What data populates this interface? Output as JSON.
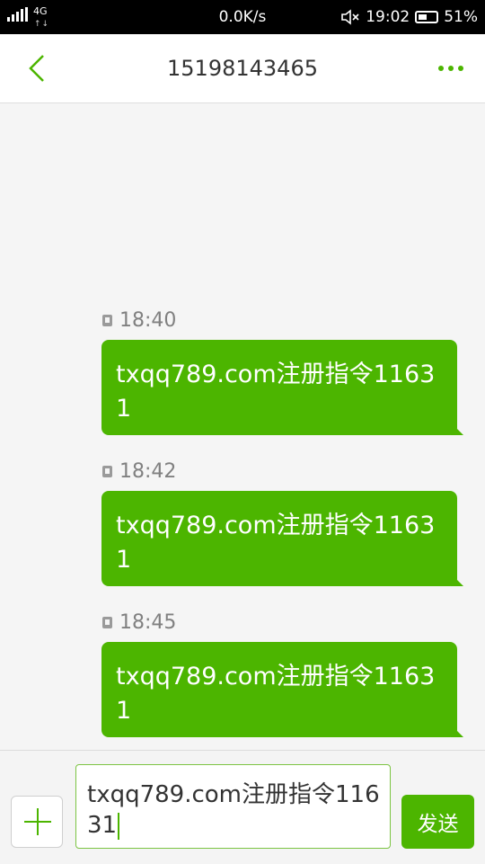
{
  "status_bar": {
    "network": "4G",
    "speed": "0.0K/s",
    "time": "19:02",
    "battery": "51%",
    "battery_level": 0.51
  },
  "header": {
    "title": "15198143465"
  },
  "messages": [
    {
      "time": "18:40",
      "text": "txqq789.com注册指令11631"
    },
    {
      "time": "18:42",
      "text": "txqq789.com注册指令11631"
    },
    {
      "time": "18:45",
      "text": "txqq789.com注册指令11631"
    }
  ],
  "compose": {
    "value": "txqq789.com注册指令11631",
    "send_label": "发送"
  },
  "colors": {
    "accent": "#4cb500",
    "background": "#f5f5f5"
  },
  "icons": {
    "back": "chevron-left-icon",
    "more": "more-dots-icon",
    "add": "plus-icon",
    "mute": "mute-icon",
    "sim": "sim-card-icon"
  }
}
